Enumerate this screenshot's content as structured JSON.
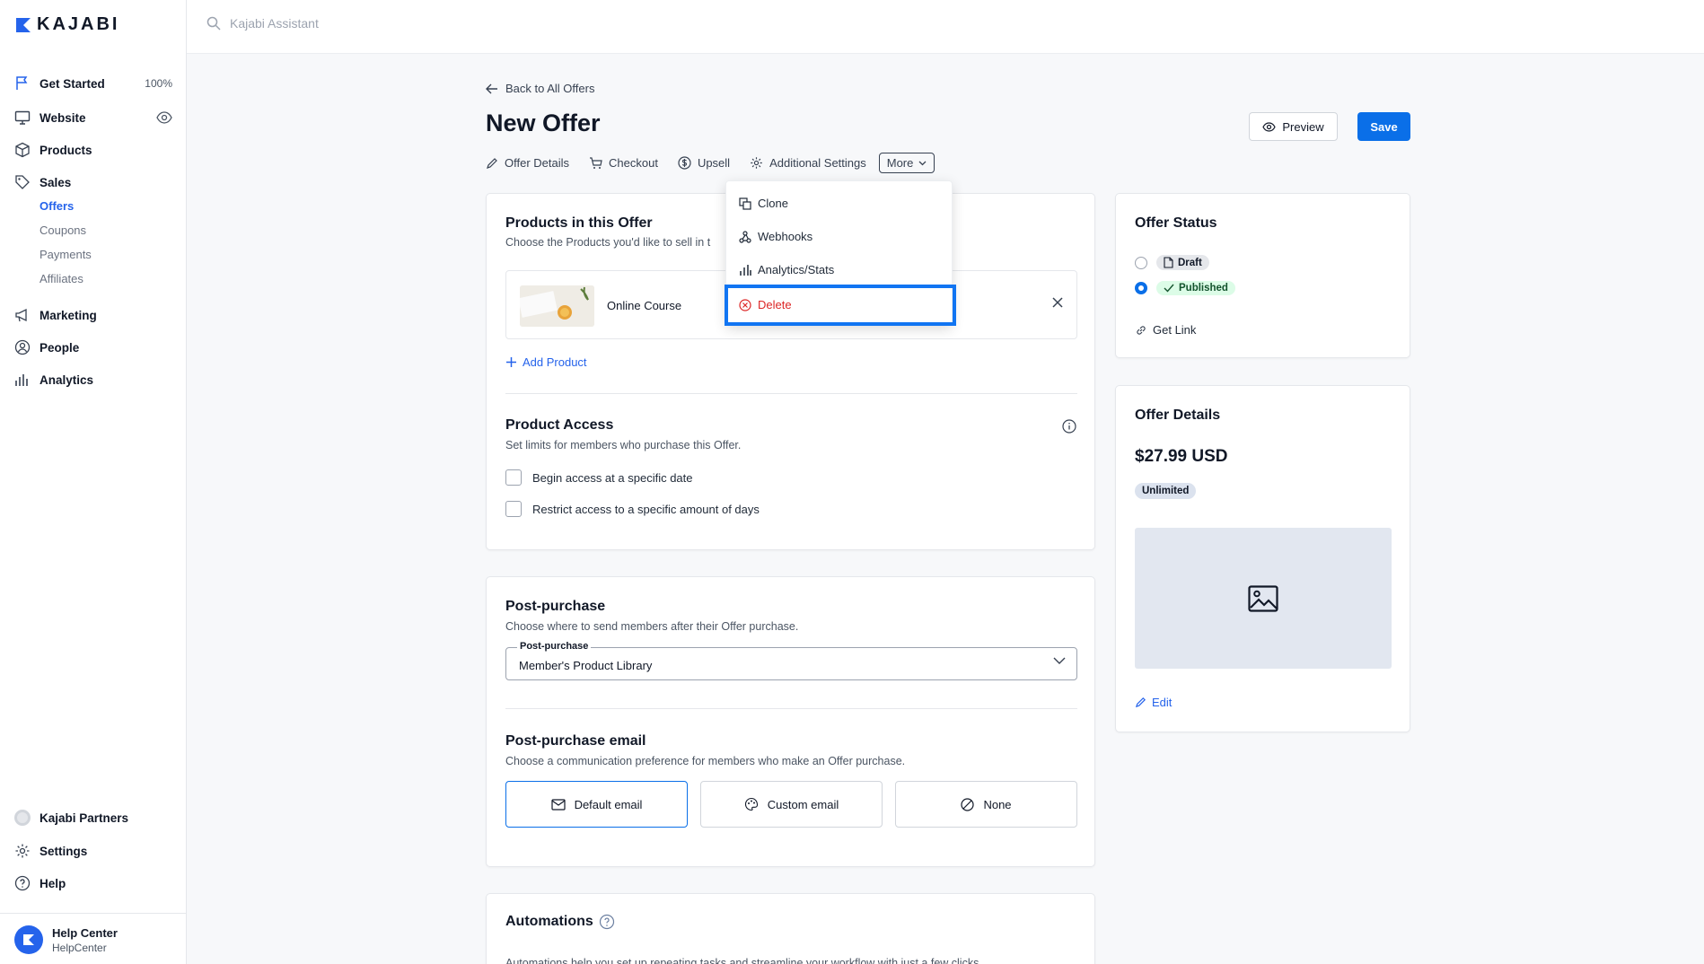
{
  "brand": {
    "name": "KAJABI"
  },
  "sidebar": {
    "items": [
      {
        "label": "Get Started",
        "right": "100%"
      },
      {
        "label": "Website"
      },
      {
        "label": "Products"
      },
      {
        "label": "Sales"
      },
      {
        "label": "Marketing"
      },
      {
        "label": "People"
      },
      {
        "label": "Analytics"
      }
    ],
    "sales_sub": [
      {
        "label": "Offers"
      },
      {
        "label": "Coupons"
      },
      {
        "label": "Payments"
      },
      {
        "label": "Affiliates"
      }
    ],
    "bottom": [
      {
        "label": "Kajabi Partners"
      },
      {
        "label": "Settings"
      },
      {
        "label": "Help"
      }
    ],
    "help_center": {
      "title": "Help Center",
      "subtitle": "HelpCenter"
    }
  },
  "topbar": {
    "search_placeholder": "Kajabi Assistant"
  },
  "page": {
    "back_link": "Back to All Offers",
    "title": "New Offer",
    "preview_label": "Preview",
    "save_label": "Save",
    "tabs": [
      "Offer Details",
      "Checkout",
      "Upsell",
      "Additional Settings",
      "More"
    ]
  },
  "more_menu": {
    "items": [
      "Clone",
      "Webhooks",
      "Analytics/Stats",
      "Delete"
    ]
  },
  "products_card": {
    "title": "Products in this Offer",
    "subtitle": "Choose the Products you'd like to sell in t",
    "product_name": "Online Course",
    "add_product": "Add Product",
    "access_title": "Product Access",
    "access_subtitle": "Set limits for members who purchase this Offer.",
    "checkbox_1": "Begin access at a specific date",
    "checkbox_2": "Restrict access to a specific amount of days"
  },
  "post_card": {
    "title": "Post-purchase",
    "subtitle": "Choose where to send members after their Offer purchase.",
    "select_label": "Post-purchase",
    "select_value": "Member's Product Library",
    "email_title": "Post-purchase email",
    "email_subtitle": "Choose a communication preference for members who make an Offer purchase.",
    "options": [
      "Default email",
      "Custom email",
      "None"
    ],
    "selected_option": "Default email"
  },
  "automations_card": {
    "title": "Automations",
    "subtitle": "Automations help you set up repeating tasks and streamline your workflow with just a few clicks."
  },
  "status_card": {
    "title": "Offer Status",
    "draft": "Draft",
    "published": "Published",
    "selected": "Published",
    "get_link": "Get Link"
  },
  "details_card": {
    "title": "Offer Details",
    "price": "$27.99 USD",
    "badge": "Unlimited",
    "edit": "Edit"
  },
  "colors": {
    "accent": "#0a6fe8",
    "danger": "#dc2626",
    "highlight": "#1175f2"
  }
}
